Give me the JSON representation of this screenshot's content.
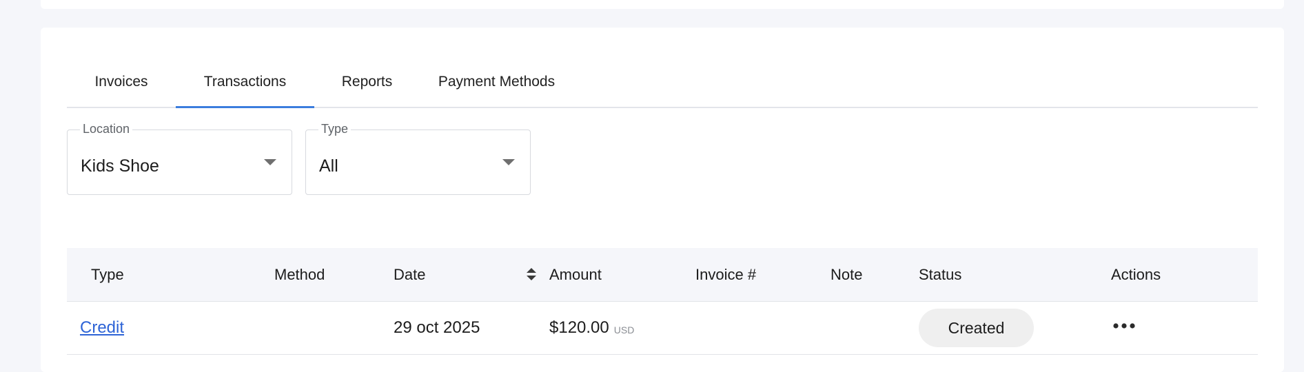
{
  "tabs": [
    {
      "label": "Invoices",
      "active": false
    },
    {
      "label": "Transactions",
      "active": true
    },
    {
      "label": "Reports",
      "active": false
    },
    {
      "label": "Payment Methods",
      "active": false
    }
  ],
  "filters": {
    "location": {
      "label": "Location",
      "value": "Kids Shoe"
    },
    "type": {
      "label": "Type",
      "value": "All"
    }
  },
  "table": {
    "headers": {
      "type": "Type",
      "method": "Method",
      "date": "Date",
      "amount": "Amount",
      "invoice": "Invoice #",
      "note": "Note",
      "status": "Status",
      "actions": "Actions"
    },
    "rows": [
      {
        "type": "Credit",
        "method": "",
        "date": "29 oct 2025",
        "amount": "$120.00",
        "currency": "USD",
        "invoice": "",
        "note": "",
        "status": "Created"
      }
    ]
  },
  "colors": {
    "accent": "#3b7ddd",
    "link": "#2d63d6",
    "page_bg": "#f5f6fa",
    "status_badge_bg": "#efefef"
  }
}
